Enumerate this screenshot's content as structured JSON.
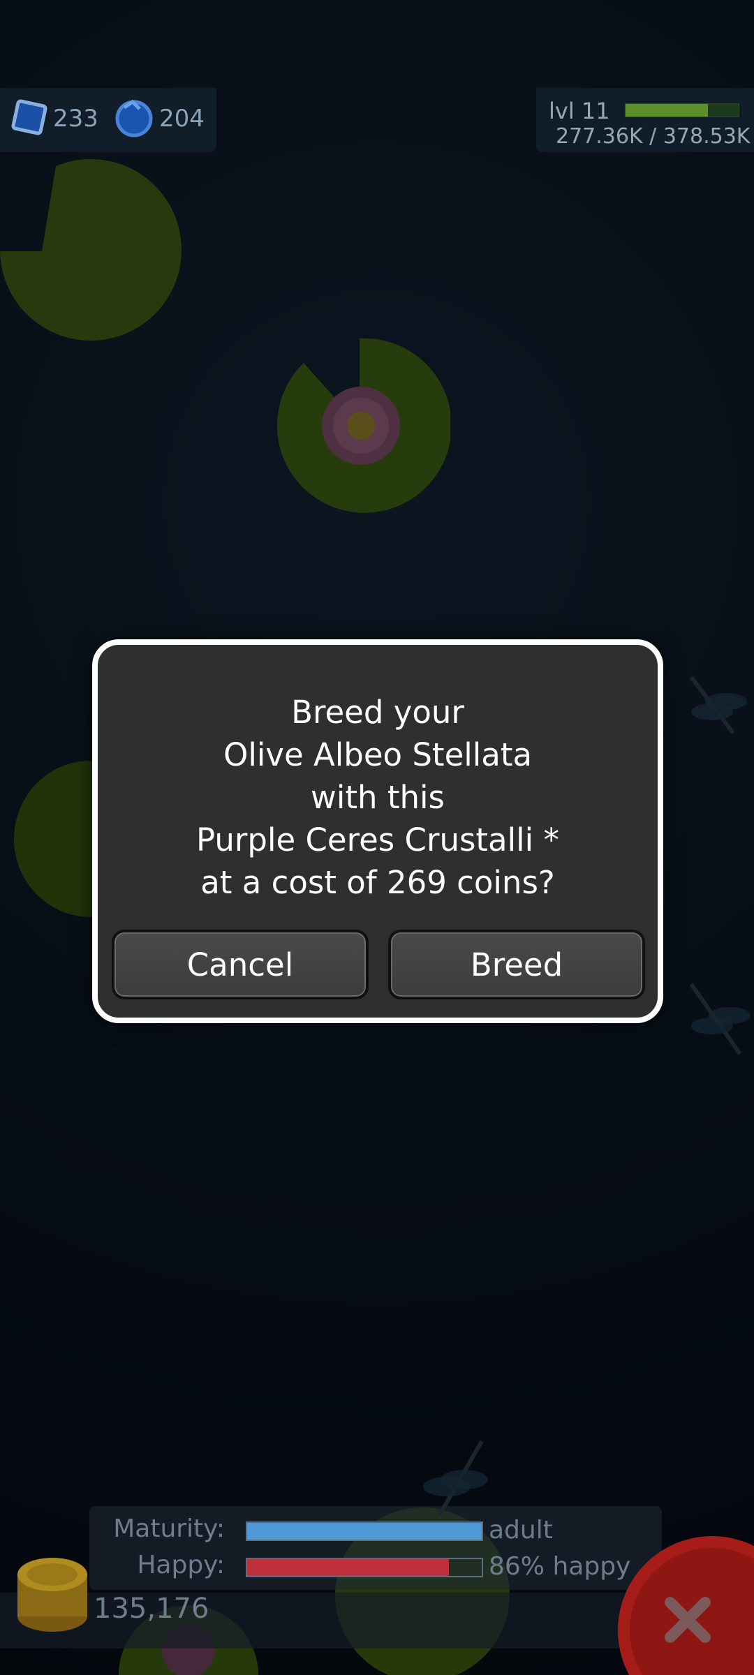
{
  "resources": {
    "blue_gems": "233",
    "blue_orbs": "204"
  },
  "level": {
    "label": "lvl 11",
    "xp_text": "277.36K / 378.53K",
    "xp_progress": 0.73
  },
  "dialog": {
    "lines": [
      "Breed your",
      "Olive Albeo Stellata",
      "with this",
      "Purple Ceres Crustalli *",
      "at a cost of 269 coins?"
    ],
    "cancel_label": "Cancel",
    "breed_label": "Breed"
  },
  "stats": {
    "maturity_label": "Maturity:",
    "maturity_value": "adult",
    "maturity_progress": 1.0,
    "happy_label": "Happy:",
    "happy_value": "86% happy",
    "happy_progress": 0.86
  },
  "coins": "135,176",
  "colors": {
    "maturity_bar": "#4e98d6",
    "happy_bar": "#c0303c",
    "xp_bar": "#5d8f2a",
    "close_button": "#c0201c"
  },
  "icons": [
    "blue-gem-icon",
    "blue-orb-icon",
    "coin-stack-icon",
    "close-icon"
  ]
}
